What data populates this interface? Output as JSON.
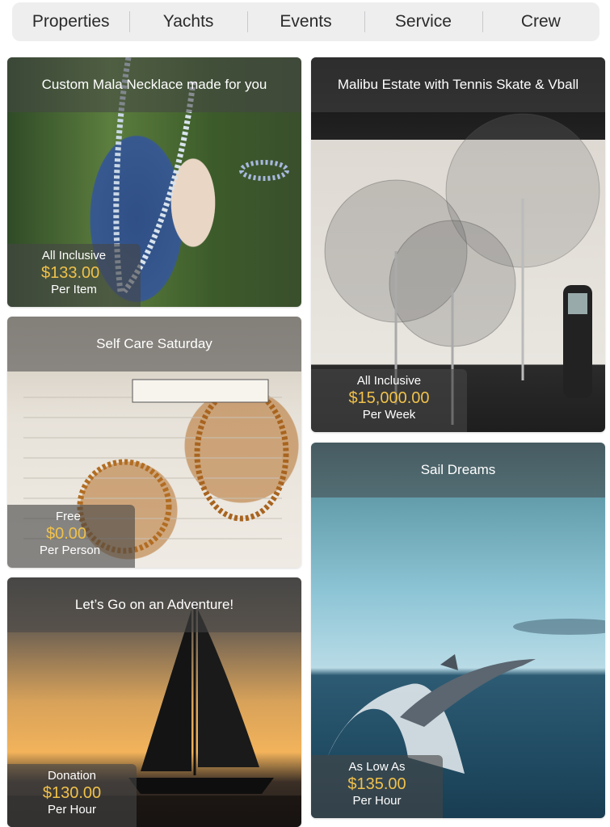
{
  "nav": {
    "items": [
      "Properties",
      "Yachts",
      "Events",
      "Service",
      "Crew"
    ]
  },
  "cards": {
    "necklace": {
      "title": "Custom Mala Necklace made for you",
      "kind": "All Inclusive",
      "price": "$133.00",
      "unit": "Per Item"
    },
    "malibu": {
      "title": "Malibu Estate with Tennis Skate & Vball",
      "kind": "All Inclusive",
      "price": "$15,000.00",
      "unit": "Per Week"
    },
    "selfcare": {
      "title": "Self Care Saturday",
      "kind": "Free",
      "price": "$0.00",
      "unit": "Per Person"
    },
    "sail": {
      "title": "Sail Dreams",
      "kind": "As Low As",
      "price": "$135.00",
      "unit": "Per Hour"
    },
    "adventure": {
      "title": "Let’s Go on an Adventure!",
      "kind": "Donation",
      "price": "$130.00",
      "unit": "Per Hour"
    }
  },
  "colors": {
    "price_accent": "#f0c14b",
    "overlay": "#464646",
    "nav_bg": "#eeeeef"
  }
}
